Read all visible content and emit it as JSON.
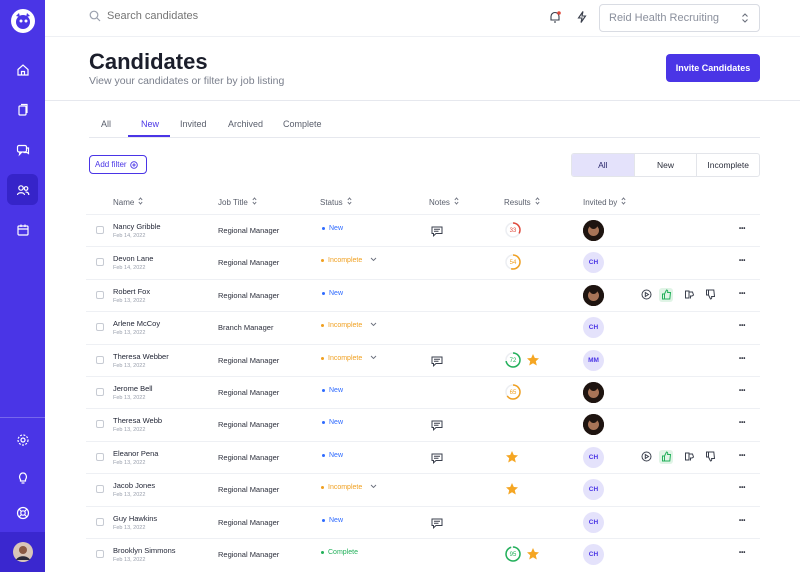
{
  "search": {
    "placeholder": "Search candidates"
  },
  "org_select": {
    "value": "Reid Health Recruiting"
  },
  "page": {
    "title": "Candidates",
    "subtitle": "View your candidates or filter by job listing",
    "invite_button": "Invite Candidates"
  },
  "tabs": [
    {
      "label": "All"
    },
    {
      "label": "New"
    },
    {
      "label": "Invited"
    },
    {
      "label": "Archived"
    },
    {
      "label": "Complete"
    }
  ],
  "active_tab": "New",
  "filter": {
    "add_label": "Add filter"
  },
  "segment": [
    {
      "label": "All"
    },
    {
      "label": "New"
    },
    {
      "label": "Incomplete"
    }
  ],
  "columns": {
    "name": "Name",
    "job": "Job Title",
    "status": "Status",
    "notes": "Notes",
    "results": "Results",
    "invited_by": "Invited by"
  },
  "colors": {
    "accent": "#4a35e6",
    "new": "#2f6bff",
    "incomplete": "#f0a020",
    "complete": "#22b05a",
    "score_red": "#e04a3c",
    "score_orange": "#f0a020",
    "score_green": "#22b05a",
    "star": "#f5a623"
  },
  "rows": [
    {
      "name": "Nancy Gribble",
      "date": "Feb 14, 2022",
      "job": "Regional Manager",
      "status": "New",
      "dropdown": false,
      "note": true,
      "score": "33",
      "score_color": "red",
      "score_pct": 0.33,
      "star": false,
      "inviter": "",
      "photo": true,
      "actions": false
    },
    {
      "name": "Devon Lane",
      "date": "Feb 14, 2022",
      "job": "Regional Manager",
      "status": "Incomplete",
      "dropdown": true,
      "note": false,
      "score": "54",
      "score_color": "orange",
      "score_pct": 0.54,
      "star": false,
      "inviter": "CH",
      "photo": false,
      "actions": false
    },
    {
      "name": "Robert Fox",
      "date": "Feb 13, 2022",
      "job": "Regional Manager",
      "status": "New",
      "dropdown": false,
      "note": false,
      "score": "",
      "score_color": "",
      "score_pct": 0,
      "star": false,
      "inviter": "",
      "photo": true,
      "actions": true
    },
    {
      "name": "Arlene McCoy",
      "date": "Feb 13, 2022",
      "job": "Branch Manager",
      "status": "Incomplete",
      "dropdown": true,
      "note": false,
      "score": "",
      "score_color": "",
      "score_pct": 0,
      "star": false,
      "inviter": "CH",
      "photo": false,
      "actions": false
    },
    {
      "name": "Theresa Webber",
      "date": "Feb 13, 2022",
      "job": "Regional Manager",
      "status": "Incomplete",
      "dropdown": true,
      "note": true,
      "score": "72",
      "score_color": "green",
      "score_pct": 0.72,
      "star": true,
      "inviter": "MM",
      "photo": false,
      "actions": false
    },
    {
      "name": "Jerome Bell",
      "date": "Feb 13, 2022",
      "job": "Regional Manager",
      "status": "New",
      "dropdown": false,
      "note": false,
      "score": "65",
      "score_color": "orange",
      "score_pct": 0.65,
      "star": false,
      "inviter": "",
      "photo": true,
      "actions": false
    },
    {
      "name": "Theresa Webb",
      "date": "Feb 13, 2022",
      "job": "Regional Manager",
      "status": "New",
      "dropdown": false,
      "note": true,
      "score": "",
      "score_color": "",
      "score_pct": 0,
      "star": false,
      "inviter": "",
      "photo": true,
      "actions": false
    },
    {
      "name": "Eleanor Pena",
      "date": "Feb 13, 2022",
      "job": "Regional Manager",
      "status": "New",
      "dropdown": false,
      "note": true,
      "score": "",
      "score_color": "",
      "score_pct": 0,
      "star": true,
      "inviter": "CH",
      "photo": false,
      "actions": true
    },
    {
      "name": "Jacob Jones",
      "date": "Feb 13, 2022",
      "job": "Regional Manager",
      "status": "Incomplete",
      "dropdown": true,
      "note": false,
      "score": "",
      "score_color": "",
      "score_pct": 0,
      "star": true,
      "inviter": "CH",
      "photo": false,
      "actions": false
    },
    {
      "name": "Guy Hawkins",
      "date": "Feb 13, 2022",
      "job": "Regional Manager",
      "status": "New",
      "dropdown": false,
      "note": true,
      "score": "",
      "score_color": "",
      "score_pct": 0,
      "star": false,
      "inviter": "CH",
      "photo": false,
      "actions": false
    },
    {
      "name": "Brooklyn Simmons",
      "date": "Feb 13, 2022",
      "job": "Regional Manager",
      "status": "Complete",
      "dropdown": false,
      "note": false,
      "score": "95",
      "score_color": "green",
      "score_pct": 0.95,
      "star": true,
      "inviter": "CH",
      "photo": false,
      "actions": false
    }
  ]
}
